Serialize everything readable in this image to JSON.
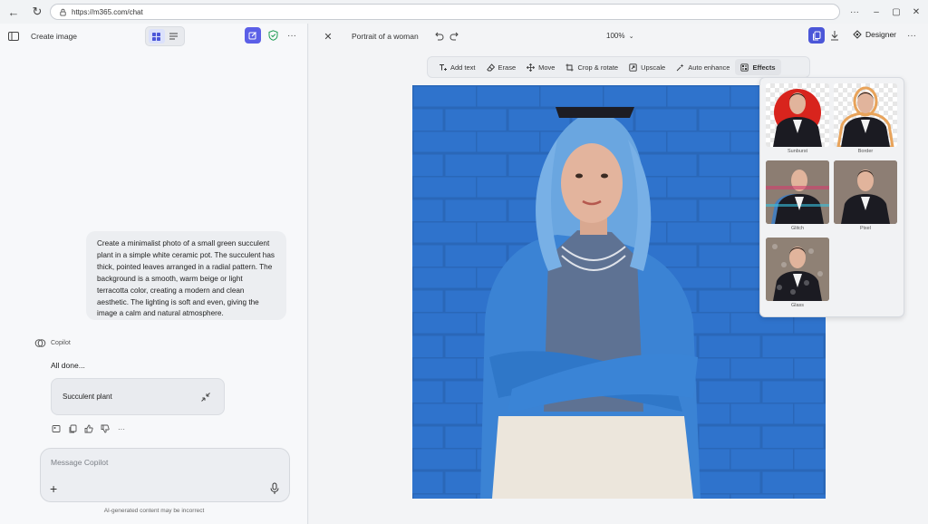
{
  "browser": {
    "url": "https://m365.com/chat",
    "more_label": "···"
  },
  "left_pane": {
    "title": "Create image",
    "more_label": "···",
    "user_message": "Create a minimalist photo of a small green succulent plant in a simple white ceramic pot. The succulent has thick, pointed leaves arranged in a radial pattern. The background is a smooth, warm beige or light terracotta color, creating a modern and clean aesthetic. The lighting is soft and even, giving the image a calm and natural atmosphere.",
    "assistant_name": "Copilot",
    "assistant_status": "All done...",
    "result_card_label": "Succulent plant",
    "composer_placeholder": "Message Copilot",
    "disclaimer": "AI-generated content may be incorrect"
  },
  "right_pane": {
    "doc_title": "Portrait of a woman",
    "zoom": "100%",
    "designer_label": "Designer",
    "more_label": "···",
    "tools": [
      {
        "label": "Add text",
        "icon": "add-text-icon"
      },
      {
        "label": "Erase",
        "icon": "eraser-icon"
      },
      {
        "label": "Move",
        "icon": "move-icon"
      },
      {
        "label": "Crop & rotate",
        "icon": "crop-icon"
      },
      {
        "label": "Upscale",
        "icon": "upscale-icon"
      },
      {
        "label": "Auto enhance",
        "icon": "sparkle-icon"
      },
      {
        "label": "Effects",
        "icon": "effects-icon"
      }
    ],
    "effects": [
      {
        "label": "Sunburst"
      },
      {
        "label": "Border"
      },
      {
        "label": "Glitch"
      },
      {
        "label": "Pixel"
      },
      {
        "label": "Glass"
      }
    ]
  },
  "colors": {
    "accent": "#5b5fe7",
    "photo_bg": "#2f73cc",
    "jacket": "#3b83d4",
    "hair": "#6aa6e0"
  }
}
